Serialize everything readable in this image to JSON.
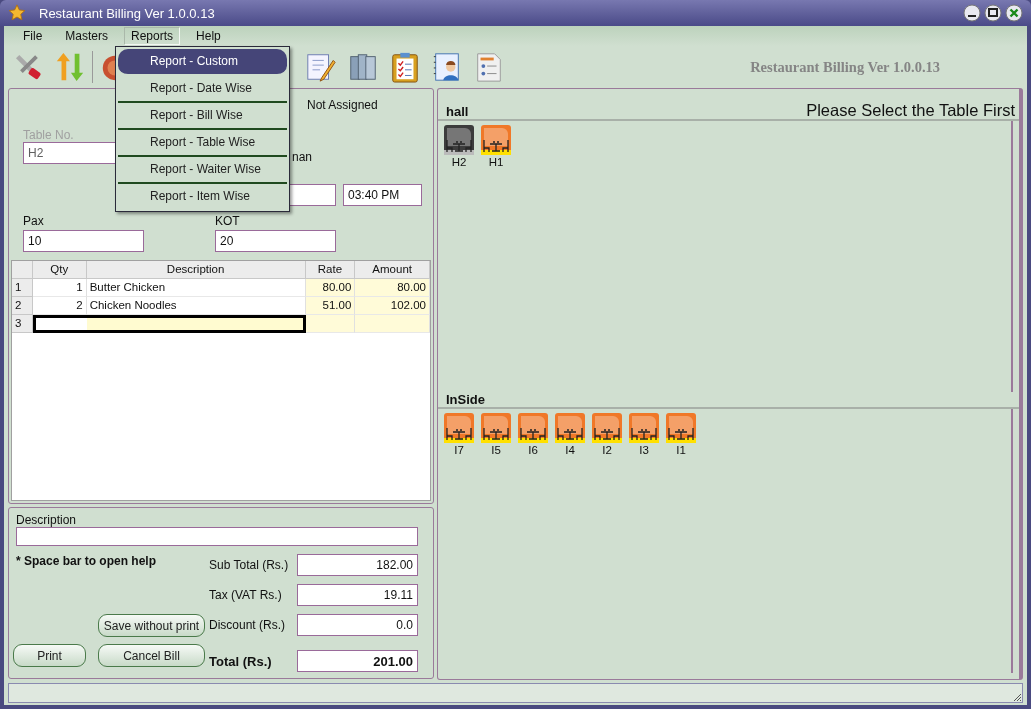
{
  "window": {
    "title": "Restaurant Billing Ver 1.0.0.13"
  },
  "menubar": [
    {
      "label": "File",
      "selected": false
    },
    {
      "label": "Masters",
      "selected": false
    },
    {
      "label": "Reports",
      "selected": true
    },
    {
      "label": "Help",
      "selected": false
    }
  ],
  "reports_menu": [
    {
      "label": "Report - Custom",
      "selected": true
    },
    {
      "label": "Report - Date Wise",
      "selected": false
    },
    {
      "label": "Report - Bill Wise",
      "selected": false
    },
    {
      "label": "Report - Table Wise",
      "selected": false
    },
    {
      "label": "Report - Waiter Wise",
      "selected": false
    },
    {
      "label": "Report - Item Wise",
      "selected": false
    }
  ],
  "toolbar_caption": "Restaurant Billing Ver 1.0.0.13",
  "form": {
    "status": "Not Assigned",
    "waiter_partial": "nan",
    "table_no": {
      "label": "Table No.",
      "value": "H2",
      "disabled": true
    },
    "time": "03:40 PM",
    "pax": {
      "label": "Pax",
      "value": "10"
    },
    "kot": {
      "label": "KOT",
      "value": "20"
    }
  },
  "grid": {
    "columns": [
      "Qty",
      "Description",
      "Rate",
      "Amount"
    ],
    "rows": [
      {
        "number": "1",
        "qty": "1",
        "description": "Butter Chicken",
        "rate": "80.00",
        "amount": "80.00",
        "selected": false
      },
      {
        "number": "2",
        "qty": "2",
        "description": "Chicken Noodles",
        "rate": "51.00",
        "amount": "102.00",
        "selected": false
      },
      {
        "number": "3",
        "selected": true
      }
    ]
  },
  "totals": {
    "description_label": "Description",
    "help_note": "* Space bar to open help",
    "lines": [
      {
        "label": "Sub Total (Rs.)",
        "value": "182.00",
        "kind": "normal"
      },
      {
        "label": "Tax (VAT Rs.)",
        "value": "19.11",
        "kind": "normal"
      },
      {
        "label": "Discount (Rs.)",
        "value": "0.0",
        "kind": "normal"
      },
      {
        "label": "Total (Rs.)",
        "value": "201.00",
        "kind": "total"
      }
    ],
    "buttons": {
      "save": "Save without print",
      "print": "Print",
      "cancel": "Cancel Bill"
    }
  },
  "tables_panel": {
    "prompt": "Please Select the Table First",
    "sections": [
      {
        "name": "hall",
        "tables": [
          {
            "label": "H2",
            "color": "#3c3c3c"
          },
          {
            "label": "H1",
            "color": "#f07828"
          }
        ]
      },
      {
        "name": "InSide",
        "tables": [
          {
            "label": "I7",
            "color": "#f07828"
          },
          {
            "label": "I5",
            "color": "#f07828"
          },
          {
            "label": "I6",
            "color": "#f07828"
          },
          {
            "label": "I4",
            "color": "#f07828"
          },
          {
            "label": "I2",
            "color": "#f07828"
          },
          {
            "label": "I3",
            "color": "#f07828"
          },
          {
            "label": "I1",
            "color": "#f07828"
          }
        ]
      }
    ]
  }
}
